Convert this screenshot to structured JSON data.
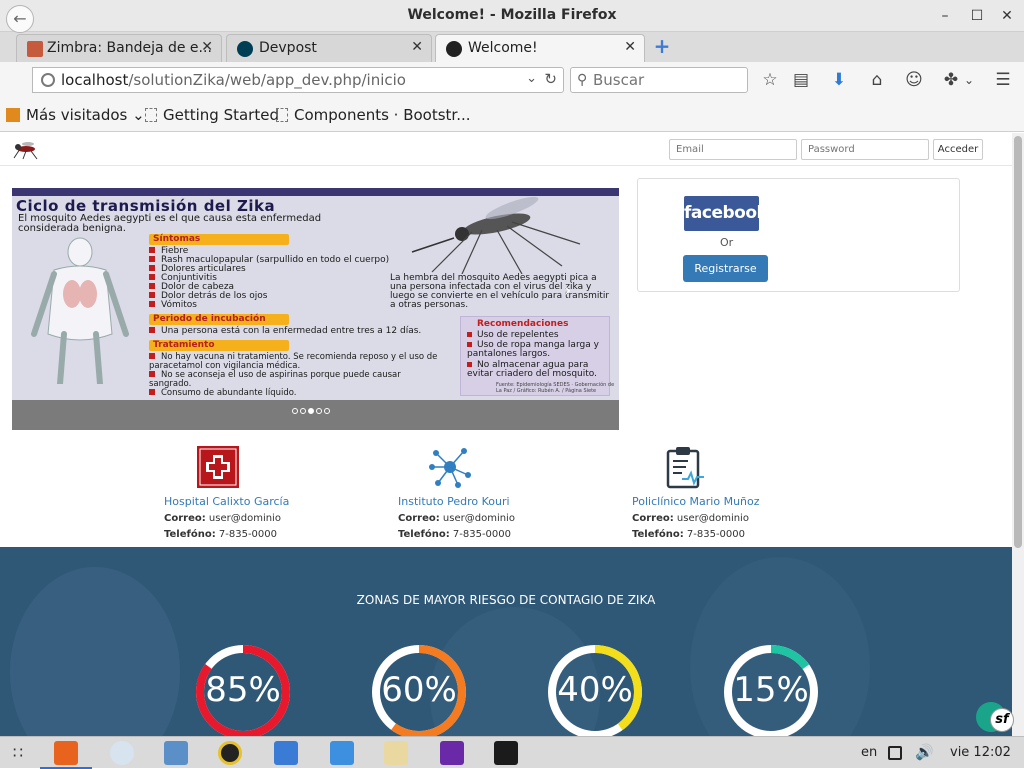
{
  "window": {
    "title": "Welcome! - Mozilla Firefox",
    "minimize": "–",
    "maximize": "☐",
    "close": "✕"
  },
  "tabs": [
    {
      "label": "Zimbra: Bandeja de e...",
      "close": "✕"
    },
    {
      "label": "Devpost",
      "close": "✕"
    },
    {
      "label": "Welcome!",
      "close": "✕"
    }
  ],
  "newtab": "+",
  "nav": {
    "url_host": "localhost",
    "url_path": "/solutionZika/web/app_dev.php/inicio",
    "search_placeholder": "Buscar"
  },
  "bookmarks": [
    {
      "label": "Más visitados"
    },
    {
      "label": "Getting Started"
    },
    {
      "label": "Components · Bootstr..."
    }
  ],
  "login": {
    "email_placeholder": "Email",
    "password_placeholder": "Password",
    "submit": "Acceder"
  },
  "slide": {
    "title": "Ciclo de transmisión del Zika",
    "intro": "El mosquito Aedes aegypti es el que causa esta enfermedad considerada benigna.",
    "sintomas_title": "Síntomas",
    "sintomas": [
      "Fiebre",
      "Rash maculopapular (sarpullido en todo el cuerpo)",
      "Dolores articulares",
      "Conjuntivitis",
      "Dolor de cabeza",
      "Dolor detrás de los ojos",
      "Vómitos"
    ],
    "incubacion_title": "Periodo de incubación",
    "incubacion": [
      "Una persona está con la enfermedad entre tres a 12 días."
    ],
    "tratamiento_title": "Tratamiento",
    "tratamiento": [
      "No hay vacuna ni tratamiento. Se recomienda reposo y el uso de paracetamol con vigilancia médica.",
      "No se aconseja el uso de aspirinas porque puede causar sangrado.",
      "Consumo de abundante líquido."
    ],
    "female_note": "La hembra del mosquito Aedes aegypti pica a una persona infectada con el virus del zika y luego se convierte en el vehículo para transmitir a otras personas.",
    "recs_title": "Recomendaciones",
    "recs": [
      "Uso de repelentes",
      "Uso de ropa manga larga y pantalones largos.",
      "No almacenar agua para evitar criadero del mosquito."
    ],
    "credit": "Fuente: Epidemiología SEDES · Gobernación de La Paz / Gráfico: Rubén A. / Página Siete"
  },
  "carousel_slides": 5,
  "carousel_active": 2,
  "facebook": {
    "button": "facebook",
    "or": "Or",
    "register": "Registrarse"
  },
  "hospitals": [
    {
      "name": "Hospital Calixto García",
      "email_label": "Correo:",
      "email": "user@dominio",
      "phone_label": "Telefóno:",
      "phone": "7-835-0000"
    },
    {
      "name": "Instituto Pedro Kouri",
      "email_label": "Correo:",
      "email": "user@dominio",
      "phone_label": "Telefóno:",
      "phone": "7-835-0000"
    },
    {
      "name": "Policlínico Mario Muñoz",
      "email_label": "Correo:",
      "email": "user@dominio",
      "phone_label": "Telefóno:",
      "phone": "7-835-0000"
    }
  ],
  "stats": {
    "title": "ZONAS DE MAYOR RIESGO DE CONTAGIO DE ZIKA",
    "items": [
      {
        "label": "85%",
        "value": 85,
        "color": "#e8192c"
      },
      {
        "label": "60%",
        "value": 60,
        "color": "#f47b20"
      },
      {
        "label": "40%",
        "value": 40,
        "color": "#f2de1a"
      },
      {
        "label": "15%",
        "value": 15,
        "color": "#1fc4a3"
      }
    ]
  },
  "taskbar": {
    "lang": "en",
    "clock": "vie 12:02"
  }
}
